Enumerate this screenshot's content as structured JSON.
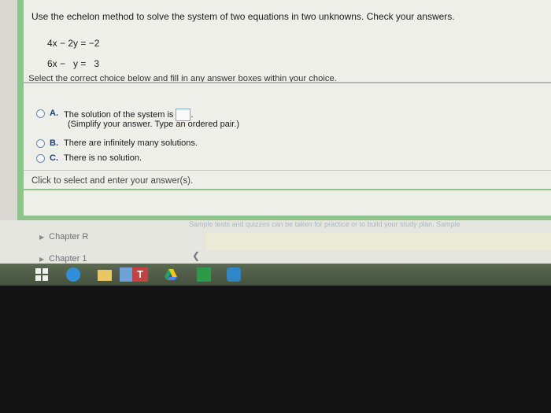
{
  "question": {
    "instruction": "Use the echelon method to solve the system of two equations in two unknowns. Check your answers.",
    "equation_1": "4x − 2y = −2",
    "equation_2": "6x −   y =   3",
    "select_instruction": "Select the correct choice below and fill in any answer boxes within your choice."
  },
  "choices": [
    {
      "letter": "A.",
      "text": "The solution of the system is",
      "hint": "(Simplify your answer. Type an ordered pair.)"
    },
    {
      "letter": "B.",
      "text": "There are infinitely many solutions."
    },
    {
      "letter": "C.",
      "text": "There is no solution."
    }
  ],
  "status_message": "Click to select and enter your answer(s).",
  "lower_page": {
    "faded_text": "Sample tests and quizzes can be taken for practice or to build your study plan. Sample",
    "chapters": [
      "Chapter R",
      "Chapter 1"
    ]
  },
  "taskbar": {
    "icons": [
      "windows-start-icon",
      "internet-explorer-icon",
      "file-explorer-icon",
      "store-icon",
      "t-app-icon",
      "google-drive-icon",
      "green-app-icon",
      "cloud-app-icon"
    ],
    "t_label": "T"
  },
  "colors": {
    "panel_border": "#8cc48a",
    "choice_letter": "#1d3f7a",
    "radio_border": "#6a8ab3"
  }
}
